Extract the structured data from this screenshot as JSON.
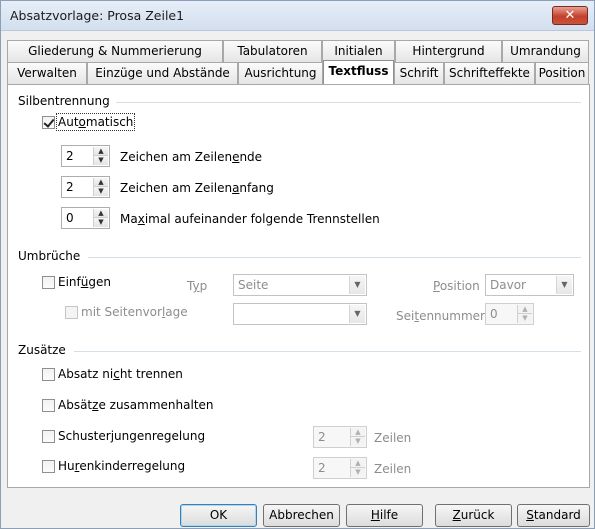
{
  "window": {
    "title": "Absatzvorlage: Prosa Zeile1",
    "close_label": "✕"
  },
  "tabs_row1": [
    {
      "label": "Gliederung & Nummerierung"
    },
    {
      "label": "Tabulatoren"
    },
    {
      "label": "Initialen"
    },
    {
      "label": "Hintergrund"
    },
    {
      "label": "Umrandung"
    }
  ],
  "tabs_row2": [
    {
      "label": "Verwalten"
    },
    {
      "label": "Einzüge und Abstände"
    },
    {
      "label": "Ausrichtung"
    },
    {
      "label": "Textfluss",
      "active": true
    },
    {
      "label": "Schrift"
    },
    {
      "label": "Schrifteffekte"
    },
    {
      "label": "Position"
    }
  ],
  "silbentrennung": {
    "title": "Silbentrennung",
    "automatisch": {
      "label_pre": "Aut",
      "label_ul": "o",
      "label_post": "matisch",
      "checked": true
    },
    "zeilenende": {
      "value": "2",
      "label_pre": "Zeichen am Zeilen",
      "label_ul": "e",
      "label_post": "nde"
    },
    "zeilenanfang": {
      "value": "2",
      "label_pre": "Zeichen am Zeilen",
      "label_ul": "a",
      "label_post": "nfang"
    },
    "trennstellen": {
      "value": "0",
      "label_pre": "Ma",
      "label_ul": "x",
      "label_post": "imal aufeinander folgende Trennstellen"
    }
  },
  "umbrueche": {
    "title": "Umbrüche",
    "einfuegen": {
      "label_pre": "Einf",
      "label_ul": "ü",
      "label_post": "gen",
      "checked": false
    },
    "typ_label_pre": "T",
    "typ_label_ul": "y",
    "typ_label_post": "p",
    "typ_value": "Seite",
    "position_label_pre": "",
    "position_label_ul": "P",
    "position_label_post": "osition",
    "position_value": "Davor",
    "mit_seitenvorlage": {
      "label_pre": "mit Seitenvor",
      "label_ul": "l",
      "label_post": "age"
    },
    "seitenvorlage_value": "",
    "seitennummer_label_pre": "Sei",
    "seitennummer_label_ul": "t",
    "seitennummer_label_post": "ennummer",
    "seitennummer_value": "0"
  },
  "zusaetze": {
    "title": "Zusätze",
    "absatz_nicht_trennen": {
      "label_pre": "Absatz ni",
      "label_ul": "c",
      "label_post": "ht trennen"
    },
    "absaetze_zusammenhalten": {
      "label_pre": "Absät",
      "label_ul": "z",
      "label_post": "e zusammenhalten"
    },
    "schusterjungen": {
      "label_pre": "Schuster",
      "label_ul": "j",
      "label_post": "ungenregelung",
      "value": "2",
      "unit": "Zeilen"
    },
    "hurenkinder": {
      "label_pre": "Hu",
      "label_ul": "r",
      "label_post": "enkinderregelung",
      "value": "2",
      "unit": "Zeilen"
    }
  },
  "buttons": {
    "ok": "OK",
    "abbrechen": "Abbrechen",
    "hilfe_pre": "",
    "hilfe_ul": "H",
    "hilfe_post": "ilfe",
    "zurueck_pre": "",
    "zurueck_ul": "Z",
    "zurueck_post": "urück",
    "standard_pre": "",
    "standard_ul": "S",
    "standard_post": "tandard"
  }
}
